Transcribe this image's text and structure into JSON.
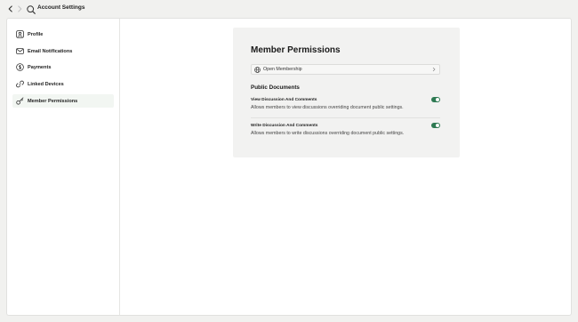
{
  "header": {
    "title": "Account Settings"
  },
  "sidebar": {
    "items": [
      {
        "label": "Profile",
        "icon": "user-icon"
      },
      {
        "label": "Email Notifications",
        "icon": "mail-icon"
      },
      {
        "label": "Payments",
        "icon": "dollar-icon"
      },
      {
        "label": "Linked Devices",
        "icon": "link-icon"
      },
      {
        "label": "Member Permissions",
        "icon": "key-icon",
        "active": true
      }
    ]
  },
  "main": {
    "title": "Member Permissions",
    "membership_select": {
      "value": "Open Membership",
      "icon": "globe-icon"
    },
    "section_title": "Public Documents",
    "permissions": [
      {
        "title": "View Discussion And Comments",
        "description": "Allows members to view discussions overriding document public settings.",
        "enabled": true
      },
      {
        "title": "Write Discussion And Comments",
        "description": "Allows members to write discussions overriding document public settings.",
        "enabled": true
      }
    ]
  },
  "colors": {
    "accent": "#2e7a52",
    "active_item_bg": "#f2f6f2",
    "card_bg": "#f2f2f1"
  }
}
